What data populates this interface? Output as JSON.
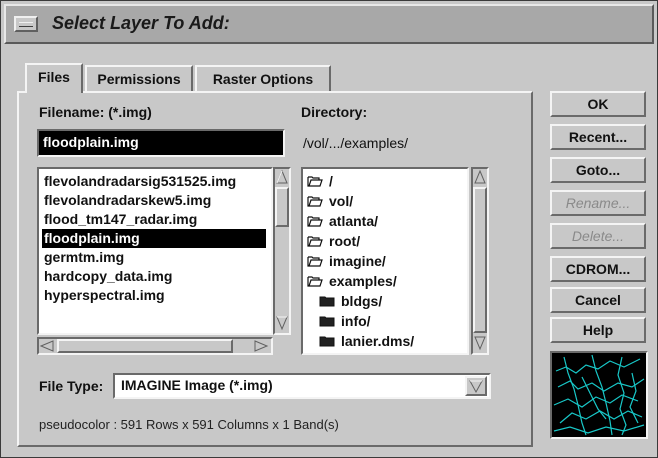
{
  "window": {
    "title": "Select Layer To Add:"
  },
  "tabs": [
    {
      "label": "Files"
    },
    {
      "label": "Permissions"
    },
    {
      "label": "Raster Options"
    }
  ],
  "filename": {
    "label": "Filename: (*.img)",
    "value": "floodplain.img"
  },
  "directory": {
    "label": "Directory:",
    "path": "/vol/.../examples/"
  },
  "files": [
    {
      "name": "flevolandradarsig531525.img",
      "selected": false
    },
    {
      "name": "flevolandradarskew5.img",
      "selected": false
    },
    {
      "name": "flood_tm147_radar.img",
      "selected": false
    },
    {
      "name": "floodplain.img",
      "selected": true
    },
    {
      "name": "germtm.img",
      "selected": false
    },
    {
      "name": "hardcopy_data.img",
      "selected": false
    },
    {
      "name": "hyperspectral.img",
      "selected": false
    }
  ],
  "directories": [
    {
      "name": "/",
      "icon": "open-folder-icon"
    },
    {
      "name": "vol/",
      "icon": "open-folder-icon"
    },
    {
      "name": "atlanta/",
      "icon": "open-folder-icon"
    },
    {
      "name": "root/",
      "icon": "open-folder-icon"
    },
    {
      "name": "imagine/",
      "icon": "open-folder-icon"
    },
    {
      "name": "examples/",
      "icon": "open-folder-icon"
    },
    {
      "name": "bldgs/",
      "icon": "closed-folder-icon"
    },
    {
      "name": "info/",
      "icon": "closed-folder-icon"
    },
    {
      "name": "lanier.dms/",
      "icon": "closed-folder-icon"
    }
  ],
  "buttons": [
    {
      "label": "OK",
      "enabled": true
    },
    {
      "label": "Recent...",
      "enabled": true
    },
    {
      "label": "Goto...",
      "enabled": true
    },
    {
      "label": "Rename...",
      "enabled": false
    },
    {
      "label": "Delete...",
      "enabled": false
    },
    {
      "label": "CDROM...",
      "enabled": true
    },
    {
      "label": "Cancel",
      "enabled": true
    },
    {
      "label": "Help",
      "enabled": true
    }
  ],
  "file_type": {
    "label": "File Type:",
    "value": "IMAGINE Image (*.img)"
  },
  "info_text": "pseudocolor : 591 Rows x 591 Columns x 1 Band(s)",
  "colors": {
    "background": "#c8c8c8",
    "preview_line": "#18c8c8",
    "selection": "#000000"
  }
}
